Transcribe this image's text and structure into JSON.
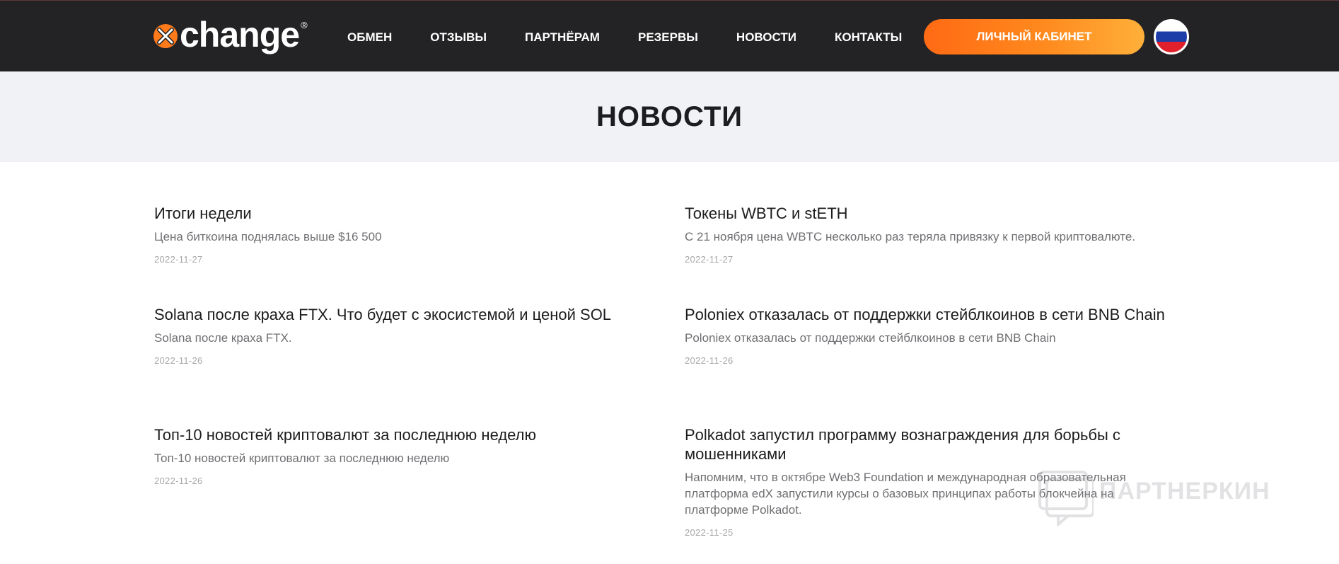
{
  "header": {
    "logo": {
      "text": "change",
      "reg": "®"
    },
    "nav": [
      {
        "label": "ОБМЕН"
      },
      {
        "label": "ОТЗЫВЫ"
      },
      {
        "label": "ПАРТНЁРАМ"
      },
      {
        "label": "РЕЗЕРВЫ"
      },
      {
        "label": "НОВОСТИ"
      },
      {
        "label": "КОНТАКТЫ"
      }
    ],
    "cabinet_button": "ЛИЧНЫЙ КАБИНЕТ",
    "language_icon": "russia-flag-icon"
  },
  "page": {
    "title": "НОВОСТИ"
  },
  "news": [
    {
      "title": "Итоги недели",
      "excerpt": "Цена биткоина поднялась выше $16 500",
      "date": "2022-11-27"
    },
    {
      "title": "Токены WBTC и stETH",
      "excerpt": "С 21 ноября цена WBTC несколько раз теряла привязку к первой криптовалюте.",
      "date": "2022-11-27"
    },
    {
      "title": "Solana после краха FTX. Что будет с экосистемой и ценой SOL",
      "excerpt": "Solana после краха FTX.",
      "date": "2022-11-26"
    },
    {
      "title": "Poloniex отказалась от поддержки стейблкоинов в сети BNB Chain",
      "excerpt": "Poloniex отказалась от поддержки стейблкоинов в сети BNB Chain",
      "date": "2022-11-26"
    },
    {
      "title": "Топ-10 новостей криптовалют за последнюю неделю",
      "excerpt": "Топ-10 новостей криптовалют за последнюю неделю",
      "date": "2022-11-26"
    },
    {
      "title": "Polkadot запустил программу вознаграждения для борьбы с мошенниками",
      "excerpt": "Напомним, что в октябре Web3 Foundation и международная образовательная платформа edX запустили курсы о базовых принципах работы блокчейна на платформе Polkadot.",
      "date": "2022-11-25"
    }
  ],
  "watermark": {
    "text": "ПАРТНЕРКИН"
  },
  "colors": {
    "header_bg": "#232325",
    "accent_orange": "#ff7a1a",
    "title_band_bg": "#f1f2f6",
    "text_dark": "#1d1d1f",
    "text_muted": "#6f6f73",
    "text_date": "#a7a7ab"
  }
}
